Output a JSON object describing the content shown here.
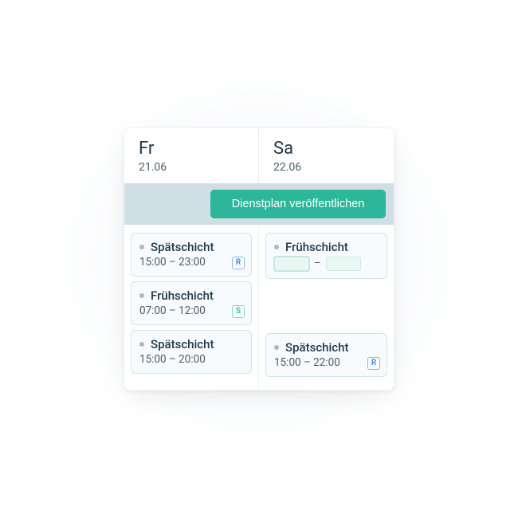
{
  "header": {
    "days": [
      {
        "abbr": "Fr",
        "date": "21.06"
      },
      {
        "abbr": "Sa",
        "date": "22.06"
      }
    ]
  },
  "publish": {
    "label": "Dienstplan veröffentlichen"
  },
  "columns": [
    {
      "shifts": [
        {
          "name": "Spätschicht",
          "time": "15:00 – 23:00",
          "tag": "R"
        },
        {
          "name": "Frühschicht",
          "time": "07:00 – 12:00",
          "tag": "S"
        },
        {
          "name": "Spätschicht",
          "time": "15:00 – 20:00"
        }
      ]
    },
    {
      "shifts": [
        {
          "name": "Frühschicht",
          "editing": true,
          "start": "",
          "end": ""
        },
        {
          "spacer": true
        },
        {
          "name": "Spätschicht",
          "time": "15:00 – 22:00",
          "tag": "R"
        }
      ]
    }
  ],
  "tag_letters": {
    "R": "R",
    "S": "S"
  },
  "separator": "–"
}
